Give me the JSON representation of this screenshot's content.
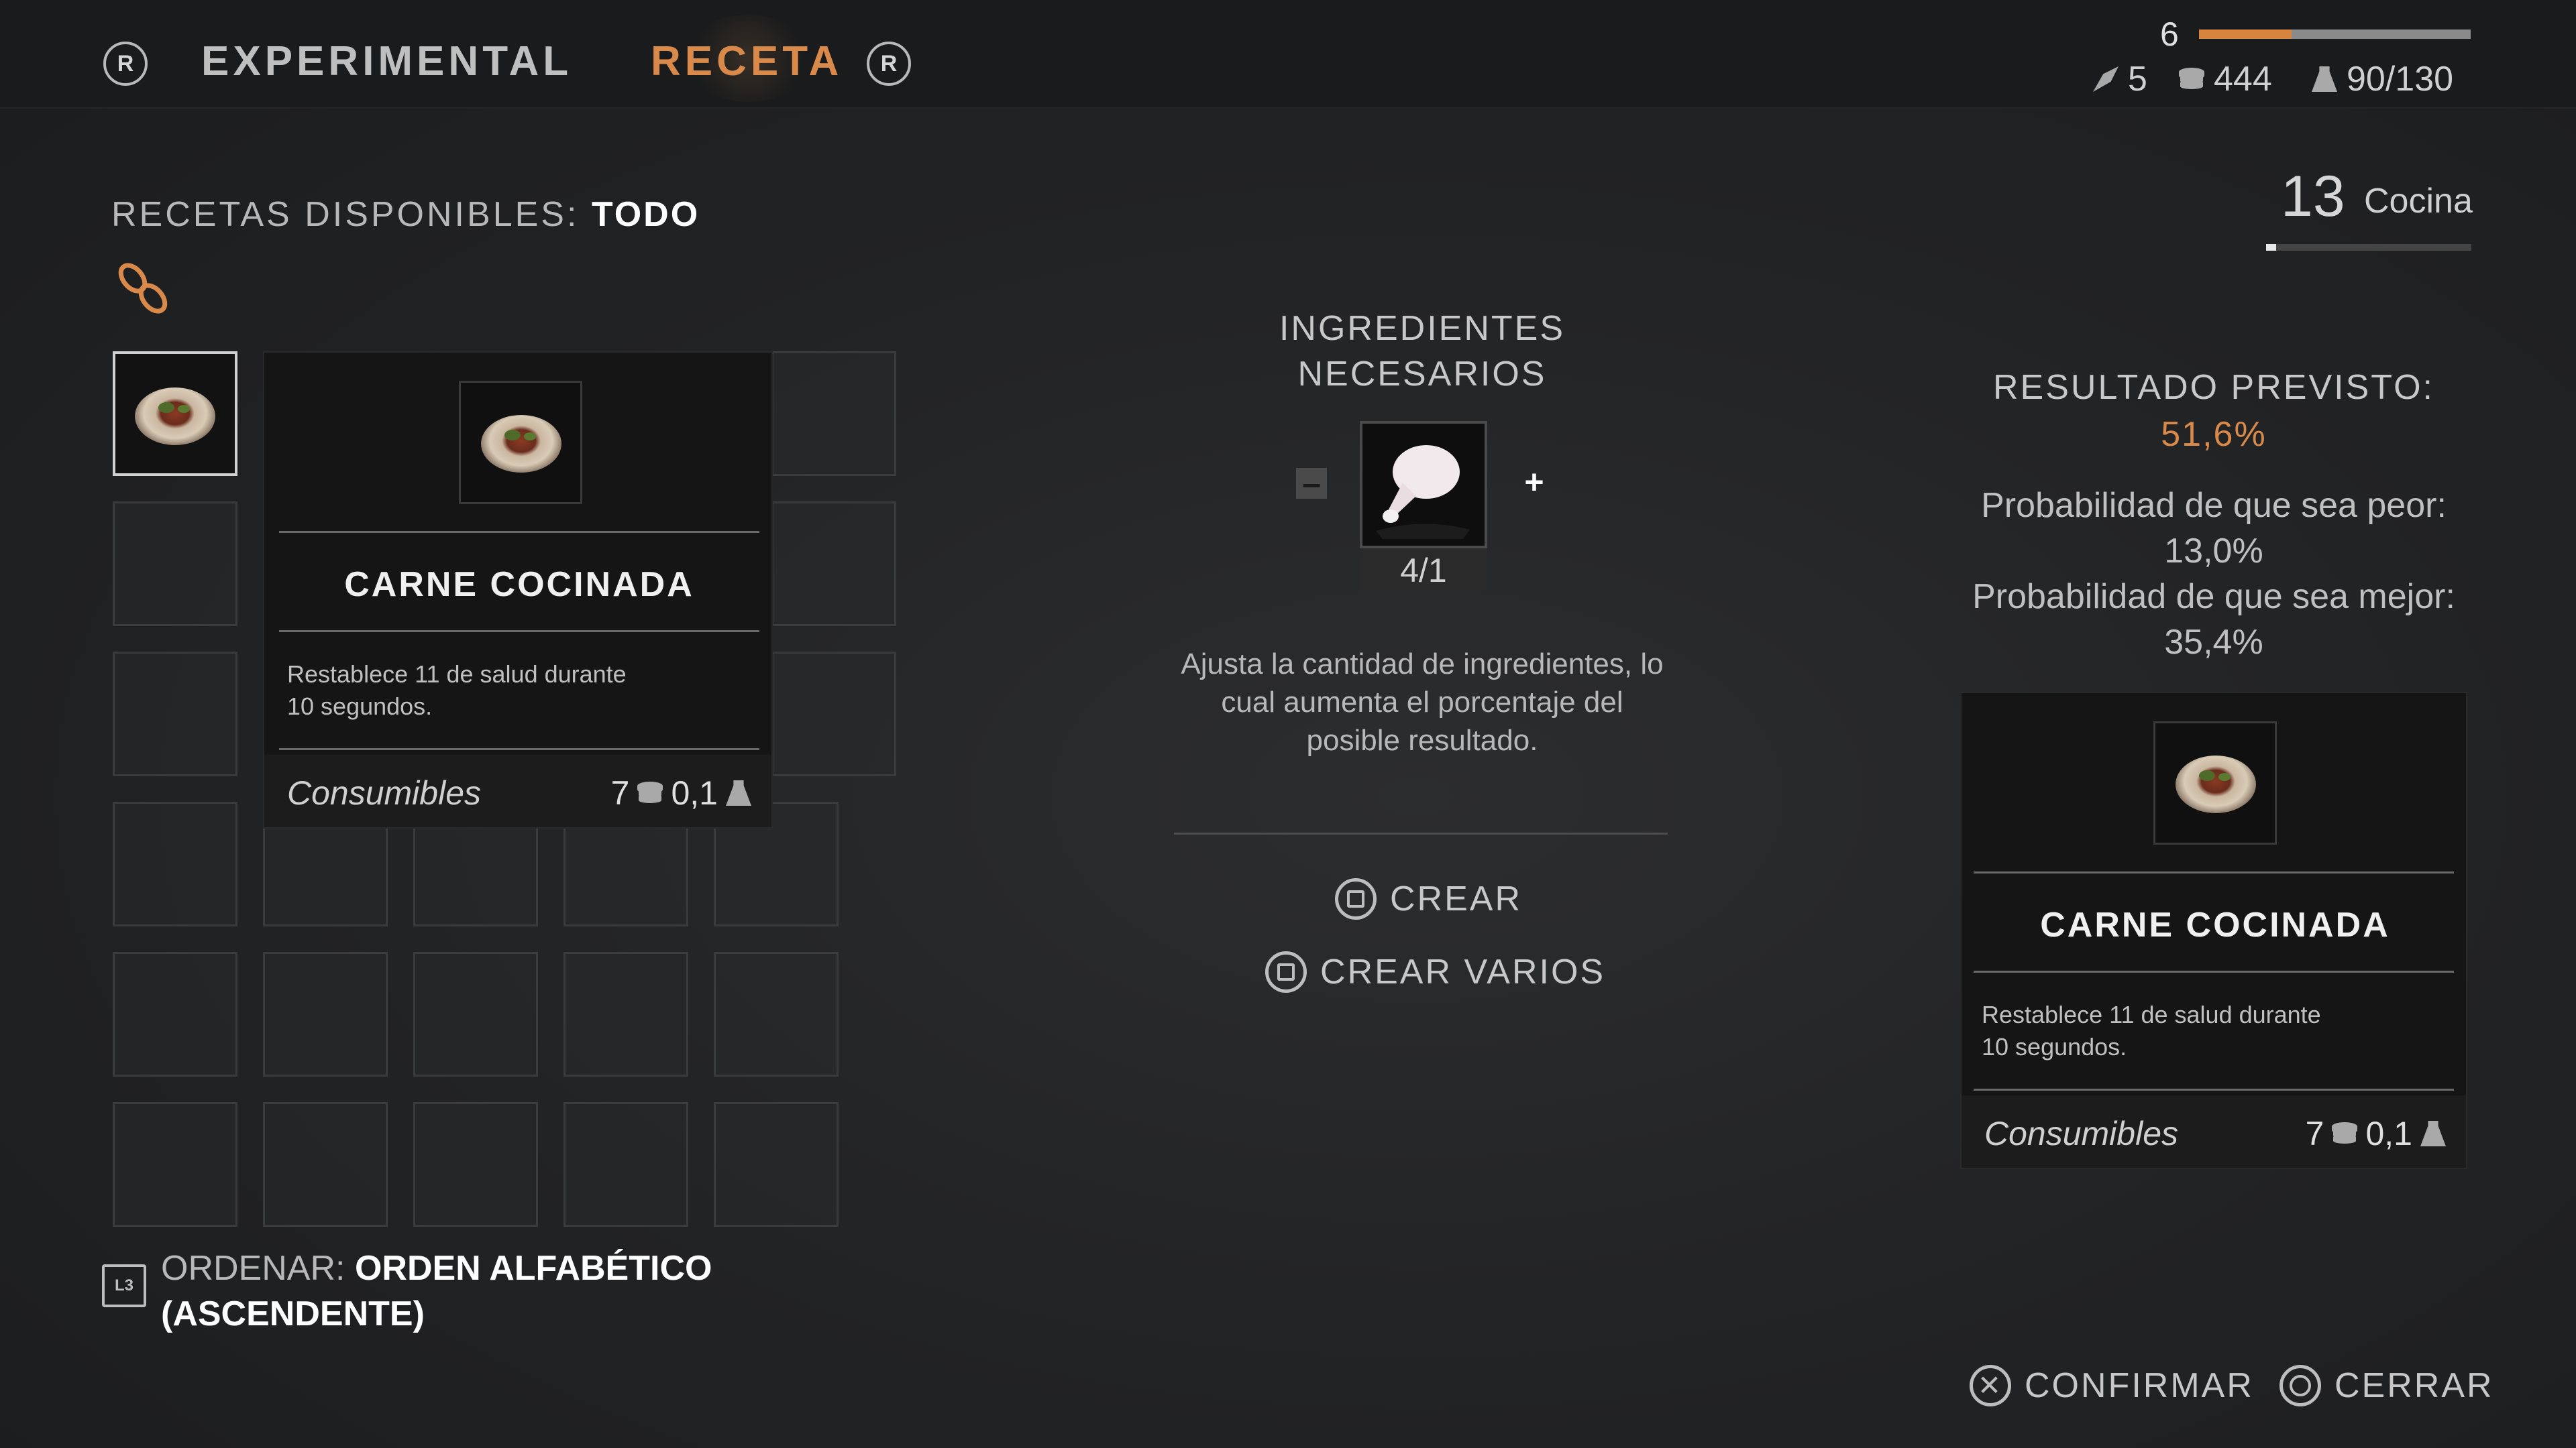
{
  "header": {
    "left_button_glyph": "R",
    "tab_experimental": "EXPERIMENTAL",
    "tab_receta": "RECETA",
    "right_button_glyph": "R",
    "level": "6",
    "xp_fraction": 0.34,
    "stat_feathers": "5",
    "stat_coins": "444",
    "stat_weight": "90/130"
  },
  "left": {
    "recetas_label": "RECETAS DISPONIBLES:",
    "recetas_filter": "TODO",
    "sort_glyph": "L3",
    "sort_label": "ORDENAR:",
    "sort_value_line1": "ORDEN ALFABÉTICO",
    "sort_value_line2": "(ASCENDENTE)"
  },
  "tooltip_left": {
    "title": "CARNE COCINADA",
    "desc_line1": "Restablece 11 de salud durante",
    "desc_line2": "10 segundos.",
    "category": "Consumibles",
    "value": "7",
    "weight": "0,1"
  },
  "center": {
    "ingredients_line1": "INGREDIENTES",
    "ingredients_line2": "NECESARIOS",
    "minus": "–",
    "plus": "+",
    "quantity": "4/1",
    "hint_line1": "Ajusta la cantidad de ingredientes, lo",
    "hint_line2": "cual aumenta el porcentaje del",
    "hint_line3": "posible resultado.",
    "crear": "CREAR",
    "crear_varios": "CREAR VARIOS"
  },
  "right": {
    "skill_level": "13",
    "skill_name": "Cocina",
    "skill_fraction": 0.05,
    "resultado_label": "RESULTADO PREVISTO:",
    "resultado_value": "51,6%",
    "worse_label": "Probabilidad de que sea peor:",
    "worse_value": "13,0%",
    "better_label": "Probabilidad de que sea mejor:",
    "better_value": "35,4%"
  },
  "tooltip_right": {
    "title": "CARNE COCINADA",
    "desc_line1": "Restablece 11 de salud durante",
    "desc_line2": "10 segundos.",
    "category": "Consumibles",
    "value": "7",
    "weight": "0,1"
  },
  "footer": {
    "confirm_glyph": "✕",
    "confirm": "CONFIRMAR",
    "close": "CERRAR"
  },
  "colors": {
    "accent": "#d98a4a",
    "background": "#232426"
  },
  "icons": [
    "r-button-icon",
    "feather-icon",
    "coins-icon",
    "weight-icon",
    "link-icon",
    "sort-icon",
    "square-button-icon",
    "cross-button-icon",
    "circle-button-icon"
  ]
}
